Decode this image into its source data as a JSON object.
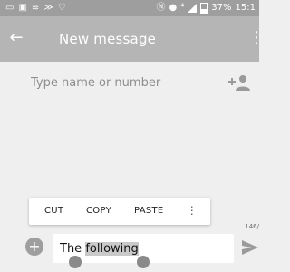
{
  "status_bar": {
    "left_icons": [
      "message-icon",
      "image-icon",
      "vibrate-icon",
      "data-icon",
      "heart-icon"
    ],
    "right_icons": [
      "nfc-icon",
      "alarm-icon",
      "network-icon",
      "signal-icon",
      "battery-icon"
    ],
    "battery_text": "37%",
    "time": "15:1"
  },
  "app_bar": {
    "title": "New message",
    "back_icon": "arrow-left-icon",
    "overflow_icon": "more-vert-icon"
  },
  "to_field": {
    "placeholder": "Type name or number",
    "value": "",
    "add_icon": "person-add-icon"
  },
  "context_menu": {
    "cut": "CUT",
    "copy": "COPY",
    "paste": "PASTE",
    "more_icon": "more-vert-icon"
  },
  "compose": {
    "text_prefix": "The ",
    "text_selected": "following",
    "char_counter": "146/",
    "attach_icon": "add-circle-icon",
    "send_icon": "send-icon"
  },
  "colors": {
    "status_bar": "#9e9e9e",
    "app_bar": "#b5b5b5",
    "background": "#efefef"
  }
}
